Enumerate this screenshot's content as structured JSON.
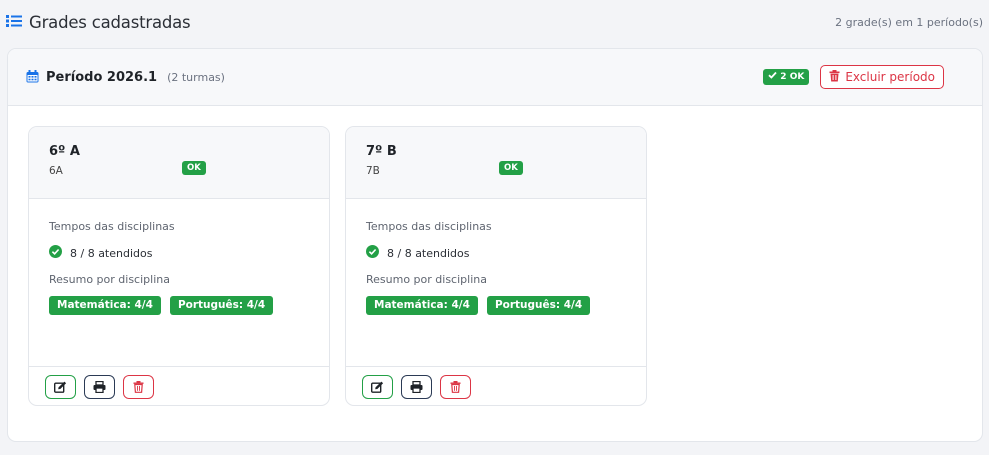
{
  "header": {
    "title": "Grades cadastradas",
    "summary": "2 grade(s) em 1 período(s)"
  },
  "period": {
    "title": "Período 2026.1",
    "subtitle": "(2 turmas)",
    "ok_badge": "2 OK",
    "delete_label": "Excluir período"
  },
  "cards": [
    {
      "name": "6º A",
      "code": "6A",
      "status_badge": "OK",
      "label_times": "Tempos das disciplinas",
      "attended": "8 / 8 atendidos",
      "label_summary": "Resumo por disciplina",
      "tags": [
        "Matemática: 4/4",
        "Português: 4/4"
      ]
    },
    {
      "name": "7º B",
      "code": "7B",
      "status_badge": "OK",
      "label_times": "Tempos das disciplinas",
      "attended": "8 / 8 atendidos",
      "label_summary": "Resumo por disciplina",
      "tags": [
        "Matemática: 4/4",
        "Português: 4/4"
      ]
    }
  ],
  "colors": {
    "accent_blue": "#1a73e8",
    "success": "#23a046",
    "danger": "#dc3545"
  },
  "icons": {
    "header": "list-icon",
    "period": "calendar-icon",
    "check": "check-icon",
    "check_circle": "check-circle-icon",
    "trash": "trash-icon",
    "edit": "edit-icon",
    "print": "print-icon"
  }
}
